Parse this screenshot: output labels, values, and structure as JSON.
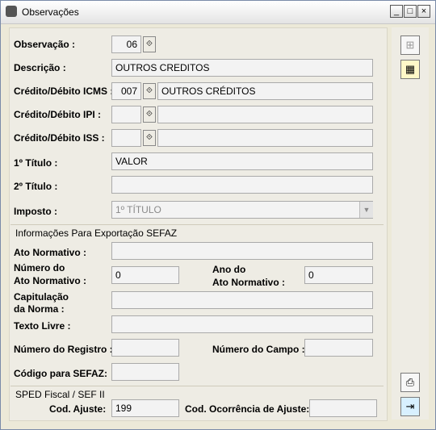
{
  "window": {
    "title": "Observações"
  },
  "form": {
    "observacao": {
      "label": "Observação :",
      "value": "06"
    },
    "descricao": {
      "label": "Descrição :",
      "value": "OUTROS CREDITOS"
    },
    "credito_icms": {
      "label": "Crédito/Débito ICMS :",
      "code": "007",
      "desc": "OUTROS CRÉDITOS"
    },
    "credito_ipi": {
      "label": "Crédito/Débito IPI :",
      "code": "",
      "desc": ""
    },
    "credito_iss": {
      "label": "Crédito/Débito ISS :",
      "code": "",
      "desc": ""
    },
    "titulo1": {
      "label": "1º Título :",
      "value": "VALOR"
    },
    "titulo2": {
      "label": "2º Título :",
      "value": ""
    },
    "imposto": {
      "label": "Imposto :",
      "value": "1º TÍTULO"
    }
  },
  "sefaz": {
    "title": "Informações Para Exportação SEFAZ",
    "ato_normativo": {
      "label": "Ato Normativo :",
      "value": ""
    },
    "numero_ato": {
      "label1": "Número do",
      "label2": "Ato Normativo :",
      "value": "0"
    },
    "ano_ato": {
      "label1": "Ano do",
      "label2": "Ato Normativo :",
      "value": "0"
    },
    "capitulacao": {
      "label1": "Capitulação",
      "label2": "da Norma :",
      "value": ""
    },
    "texto_livre": {
      "label": "Texto Livre :",
      "value": ""
    },
    "numero_registro": {
      "label": "Número do Registro :",
      "value": ""
    },
    "numero_campo": {
      "label": "Número do Campo :",
      "value": ""
    },
    "codigo_sefaz": {
      "label": "Código para SEFAZ:",
      "value": ""
    }
  },
  "sped": {
    "title": "SPED Fiscal / SEF II",
    "cod_ajuste": {
      "label": "Cod. Ajuste:",
      "value": "199"
    },
    "cod_ocorrencia": {
      "label": "Cod. Ocorrência de Ajuste:",
      "value": ""
    }
  },
  "icons": {
    "titlebar": [
      "app-icon",
      "minimize-icon",
      "maximize-icon",
      "close-icon"
    ],
    "side": [
      "tree-icon",
      "table-icon",
      "print-icon",
      "exit-icon"
    ]
  }
}
